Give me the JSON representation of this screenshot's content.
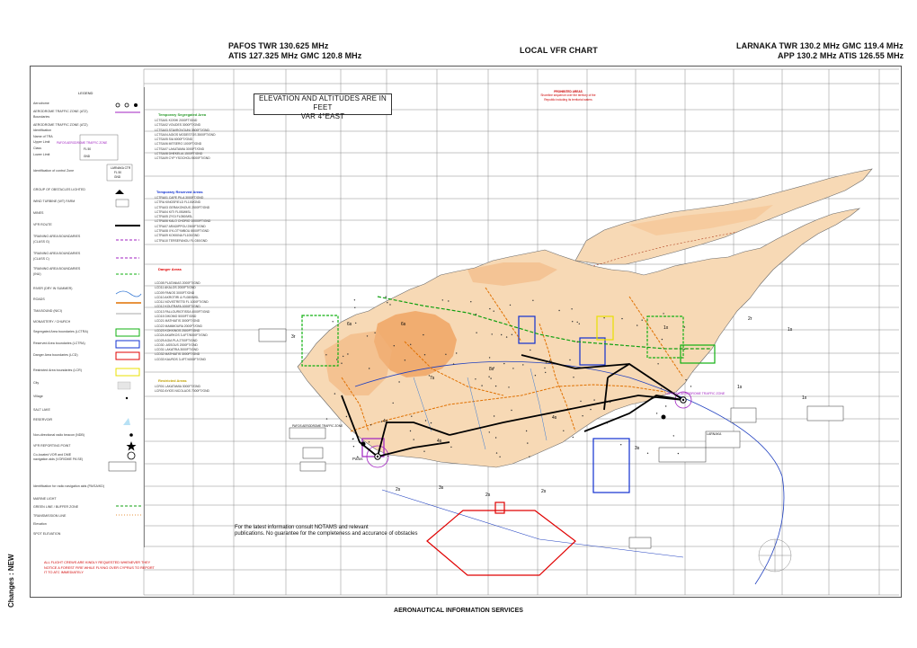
{
  "header": {
    "left_line1": "PAFOS TWR 130.625 MHz",
    "left_line2": "ATIS 127.325 MHz    GMC 120.8 MHz",
    "center": "LOCAL VFR CHART",
    "right_line1": "LARNAKA TWR 130.2 MHz    GMC 119.4 MHz",
    "right_line2": "APP 130.2 MHz    ATIS 126.55 MHz"
  },
  "elevation_box": {
    "line1": "ELEVATION AND ALTITUDES ARE IN FEET",
    "line2": "VAR 4°EAST"
  },
  "prohibited_note": {
    "title": "PROHIBITED AREAS",
    "line1": "Shoreline sequence over the territory of the",
    "line2": "Republic including its territorial waters"
  },
  "legend": {
    "title": "LEGEND",
    "rows": [
      "Aerodrome",
      "AERODROME TRAFFIC ZONE (ATZ)",
      "Boundaries",
      "AERODROME TRAFFIC ZONE (ATZ)",
      "Identification",
      "Name of TRA",
      "Upper Limit",
      "Class",
      "Lower Limit",
      "Identification of control Zone",
      "GROUP OF OBSTACLES LIGHTED",
      "WIND TURBINE (WT) FARM",
      "MINES",
      "VFR ROUTE",
      "TRAINING AREA BOUNDARIES",
      "(CLASS G)",
      "TRAINING AREA BOUNDARIES",
      "(CLASS C)",
      "TRAINING AREA BOUNDARIES",
      "(INU)",
      "RIVER (DRY IN SUMMER)",
      "ROADS",
      "TMA BOUND (NICI)",
      "MONASTERY / CHURCH",
      "Segregated Area boundaries (LCTRA)",
      "Reserved Area boundaries (LCTRA)",
      "Danger Area boundaries (LCD)",
      "Restricted Area boundaries (LCR)",
      "City",
      "Village",
      "SALT LAKE",
      "RESERVOIR",
      "Non-directional radio beacon (NDB)",
      "VFR REPORTING POINT",
      "Co-located VOR and DME",
      "navigation aids (VOR/DME PA SE)",
      "Identification for radio navigation aids (PA/SA/KD)",
      "MARINE LIGHT",
      "GREEN LINE / BUFFER ZONE",
      "TRANSMISSION LINE",
      "Elevation",
      "SPOT ELEVATION"
    ],
    "tra_sample": {
      "name": "PAFOS AERODROME TRAFFIC ZONE",
      "upper": "FL 50",
      "lower": "GND",
      "ctr_name": "LARNAKA CTR",
      "ctr_upper": "FL 50",
      "ctr_lower": "GND"
    }
  },
  "columns": {
    "segregated": {
      "title": "Temporary Segregated Area",
      "items": [
        "LCTSA01 KOSHI 2000FT/GND",
        "LCTSA02 VOUDES 3000FT/GND",
        "LCTSA03 STAVROVOUNI 3500FT/GND",
        "LCTSA04 AGIOS MODESTOS 3500FT/GND",
        "LCTSA05 SIA 6000FT/GND",
        "LCTSA06 MITSERO 1000FT/GND",
        "LCTSA07 LAKATAMIA 3000FT/GND",
        "LCTSA08 DHEKELIA 1500FT/GND",
        "LCTSA09 CYP YSOCHOU 8000FT/GND"
      ]
    },
    "reserved": {
      "title": "Temporary Reserved Areas",
      "items": [
        "LCTRA01 CAPE PILA 3000FT/GND",
        "LCTRA KINGSFIELD FL100/GND",
        "LCTRA03 GERAKONOUS 2500FT/GND",
        "LCTRA04 KITI FL050/MSL",
        "LCTRA05 ZYGI FL050/MSL",
        "LCTRA06 KALO CHORIO 10000FT/GND",
        "LCTRA07 ARADIPPOU 2500FT/GND",
        "LCTRA08 XYLOTYMBOU 8000FT/GND",
        "LCTRA09 KOKKINA FL100/GND",
        "LCTRA10 TERSEFANOU FL 030/GND"
      ]
    },
    "danger": {
      "title": "Danger Areas",
      "items": [
        "LCD08 PLATANIAS 2000FT/GND",
        "LCD11 AKALOS 2000FT/GND",
        "LCD09 PANOS 3000FT/GND",
        "LCD10 AKROTIRI & FL080/MSL",
        "LCD11 NOVISTRETSI FL 1000FT/GND",
        "LCD12 KOUTRAFA 1000FT/GND",
        "LCD13 PALLOURIOTISSA 4000FT/GND",
        "LCD15 DIKOMO 5000FT/GND",
        "LCD21 MATHIATIS 3000FT/GND",
        "LCD22 MAMMOURA 2000FT/GND",
        "LCD23 KOKKINOS 2500FT/GND",
        "LCD24 AKARKOS 3-4FT/5000FT/GND",
        "LCD25 AGIA PLA 2700FT/GND",
        "LCD30 -ASSOUS 2000FT/GND",
        "LCD31 LAKATRIA 3000FT/GND",
        "LCD32 MATHIATIS 3000FT/GND",
        "LCD33 KAUROS 3-4FT/4000FT/GND"
      ]
    },
    "restricted": {
      "title": "Restricted Areas",
      "items": [
        "LCR01 LAKATAMIA 3000FT/GND",
        "LCR02 AYIOS NICOLAOS 7000FT/GND"
      ]
    }
  },
  "map_labels": {
    "pafos": "Pafos",
    "larnaka_atz": "LARNAKA AERODROME TRAFFIC ZONE",
    "pafos_atz": "PAFOS AERODROME TRAFFIC ZONE",
    "larnaka": "LARNAKA",
    "sector_labels": [
      "1s",
      "1s",
      "2s",
      "2s",
      "2s",
      "3s",
      "3s",
      "4s",
      "4s",
      "4s",
      "6s",
      "6s",
      "7s",
      "8s",
      "1x",
      "1x",
      "2r",
      "3r"
    ]
  },
  "footnote": {
    "line1": "For the latest information consult NOTAMS and relevant",
    "line2": "publications. No guarantee for the completeness and accurance of obstacles"
  },
  "red_note": {
    "line1": "ALL FLIGHT CREWS ARE KINDLY REQUESTED WHENEVER THEY",
    "line2": "NOTICE A FOREST FIRE WHILE FLYING OVER CYPRUS TO REPORT",
    "line3": "IT TO ATC IMMEDIATELY"
  },
  "side_label": "Changes  :  NEW",
  "footer": "AERONAUTICAL INFORMATION SERVICES",
  "colors": {
    "land": "#f7d9b5",
    "terrain_high": "#ef9d5a",
    "sea": "#ffffff",
    "grid": "#8a8a8a",
    "vfr_route": "#000000",
    "atz": "#a020c0",
    "green_area": "#10b010",
    "blue_area": "#1030d0",
    "yellow_area": "#e8e000",
    "red_area": "#e00000",
    "roads": "#e07000"
  }
}
